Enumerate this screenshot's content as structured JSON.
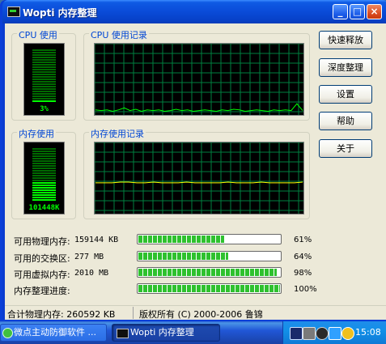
{
  "window": {
    "title": "Wopti 内存整理",
    "minimize": "_",
    "maximize": "□",
    "close": "×"
  },
  "groups": {
    "cpu_usage": "CPU 使用",
    "cpu_history": "CPU 使用记录",
    "mem_usage": "内存使用",
    "mem_history": "内存使用记录"
  },
  "meters": {
    "cpu": {
      "text": "3%",
      "level": 0.03
    },
    "mem": {
      "text": "101448K",
      "level": 0.38
    }
  },
  "buttons": {
    "quick_release": "快速释放",
    "deep_clean": "深度整理",
    "settings": "设置",
    "help": "帮助",
    "about": "关于"
  },
  "stats": [
    {
      "label": "可用物理内存:",
      "value": "159144 KB",
      "percent_label": "61%",
      "percent": 61
    },
    {
      "label": "可用的交换区:",
      "value": "277 MB",
      "percent_label": "64%",
      "percent": 64
    },
    {
      "label": "可用虚拟内存:",
      "value": "2010 MB",
      "percent_label": "98%",
      "percent": 98
    },
    {
      "label": "内存整理进度:",
      "value": "",
      "percent_label": "100%",
      "percent": 100
    }
  ],
  "status": {
    "total_memory": "合计物理内存: 260592 KB",
    "copyright": "版权所有 (C) 2000-2006 鲁锦"
  },
  "taskbar": {
    "task1": "微点主动防御软件 ...",
    "task2": "Wopti 内存整理",
    "clock": "15:08"
  },
  "colors": {
    "graph_grid": "#008040",
    "graph_line": "#00ff00",
    "mem_line": "#ffff00",
    "group_label": "#0046d5",
    "progress_fill": "#2ec12e"
  }
}
